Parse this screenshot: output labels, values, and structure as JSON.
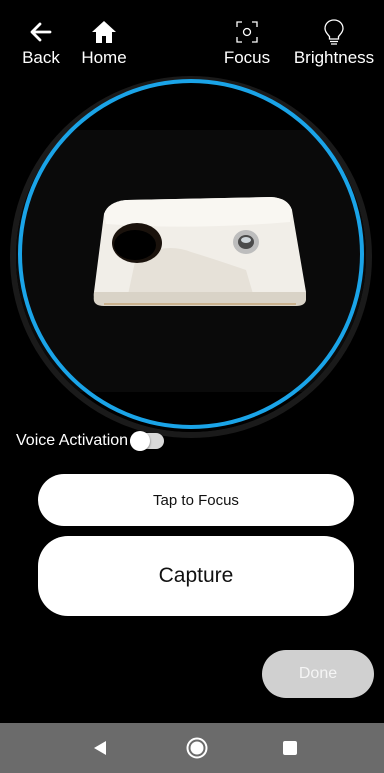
{
  "topbar": {
    "back_label": "Back",
    "home_label": "Home",
    "focus_label": "Focus",
    "brightness_label": "Brightness",
    "icons": {
      "back": "arrow-left-icon",
      "home": "home-icon",
      "focus": "focus-frame-icon",
      "brightness": "lightbulb-icon"
    }
  },
  "viewer": {
    "accent_color": "#1aa4e8"
  },
  "voice_activation": {
    "label": "Voice Activation",
    "enabled": false
  },
  "buttons": {
    "tap_to_focus": "Tap to Focus",
    "capture": "Capture",
    "done": "Done",
    "done_enabled": false
  },
  "navbar": {
    "icons": [
      "triangle-back-icon",
      "circle-home-icon",
      "square-recents-icon"
    ]
  }
}
